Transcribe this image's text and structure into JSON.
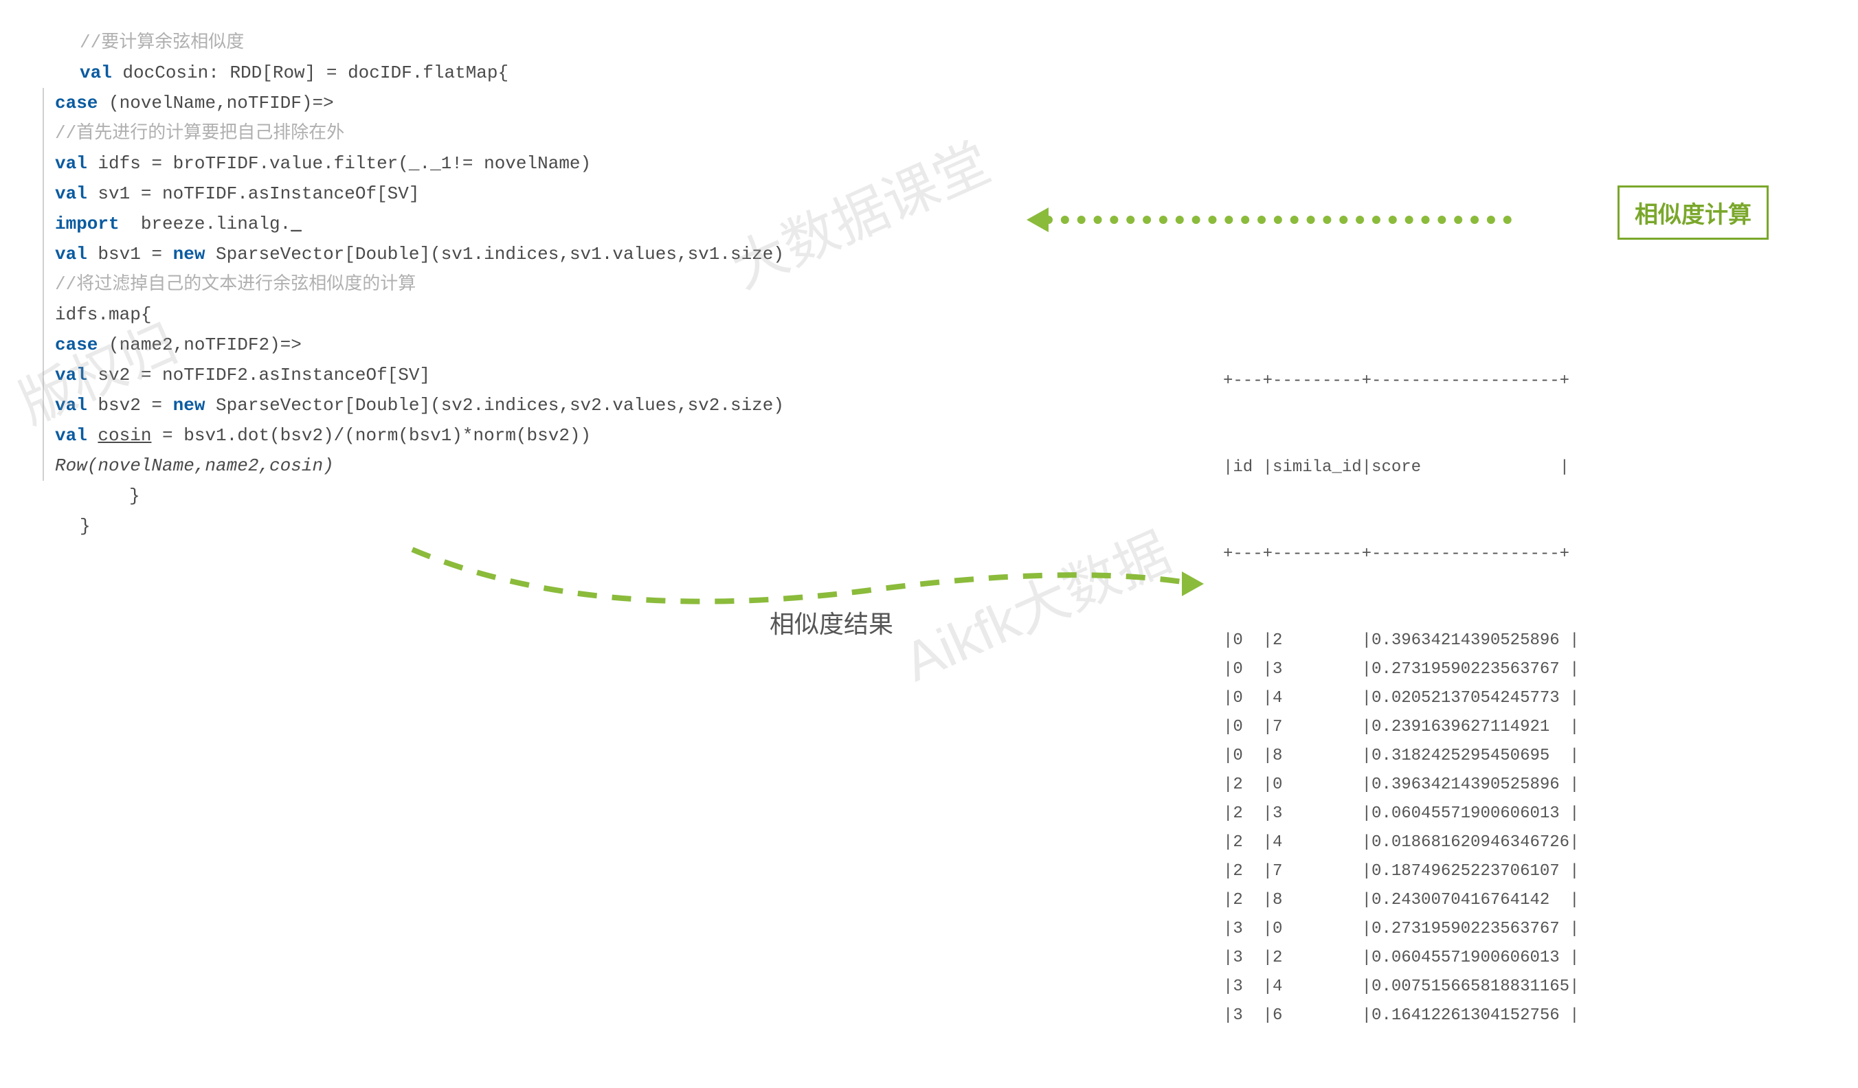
{
  "annotations": {
    "calc_label": "相似度计算",
    "result_label": "相似度结果"
  },
  "code": {
    "c1": "//要计算余弦相似度",
    "l2_kw1": "val",
    "l2_t1": " docCosin: RDD[Row] = docIDF.flatMap{",
    "l3_kw1": "case",
    "l3_t1": " (novelName,noTFIDF)=>",
    "c2": "//首先进行的计算要把自己排除在外",
    "l5_kw1": "val",
    "l5_t1": " idfs = broTFIDF.value.filter(_._1!= novelName)",
    "l6_kw1": "val",
    "l6_t1": " sv1 = noTFIDF.asInstanceOf[SV]",
    "l7_kw1": "import",
    "l7_t1": "  breeze.linalg.",
    "l7_u": "_",
    "l8_kw1": "val",
    "l8_t1": " bsv1 = ",
    "l8_kw2": "new",
    "l8_t2": " SparseVector[Double](sv1.indices,sv1.values,sv1.size)",
    "c3": "//将过滤掉自己的文本进行余弦相似度的计算",
    "l10_t1": "idfs.map{",
    "l11_kw1": "case",
    "l11_t1": " (name2,noTFIDF2)=>",
    "l12_kw1": "val",
    "l12_t1": " sv2 = noTFIDF2.asInstanceOf[SV]",
    "l13_kw1": "val",
    "l13_t1": " bsv2 = ",
    "l13_kw2": "new",
    "l13_t2": " SparseVector[Double](sv2.indices,sv2.values,sv2.size)",
    "l14_kw1": "val",
    "l14_t1": " ",
    "l14_u": "cosin",
    "l14_t2": " = bsv1.dot(bsv2)/(norm(bsv1)*norm(bsv2))",
    "l15_t1": "Row(novelName,name2,cosin)",
    "l16_t1": "}",
    "l17_t1": "}"
  },
  "table": {
    "top": "+---+---------+-------------------+",
    "header": "|id |simila_id|score              |",
    "sep": "+---+---------+-------------------+",
    "rows": [
      "|0  |2        |0.39634214390525896 |",
      "|0  |3        |0.27319590223563767 |",
      "|0  |4        |0.02052137054245773 |",
      "|0  |7        |0.2391639627114921  |",
      "|0  |8        |0.3182425295450695  |",
      "|2  |0        |0.39634214390525896 |",
      "|2  |3        |0.06045571900606013 |",
      "|2  |4        |0.018681620946346726|",
      "|2  |7        |0.18749625223706107 |",
      "|2  |8        |0.2430070416764142  |",
      "|3  |0        |0.27319590223563767 |",
      "|3  |2        |0.06045571900606013 |",
      "|3  |4        |0.007515665818831165|",
      "|3  |6        |0.16412261304152756 |"
    ]
  },
  "watermarks": {
    "w1": "大数据课堂",
    "w2": "Aikfk大数据",
    "w3": "版权归"
  }
}
